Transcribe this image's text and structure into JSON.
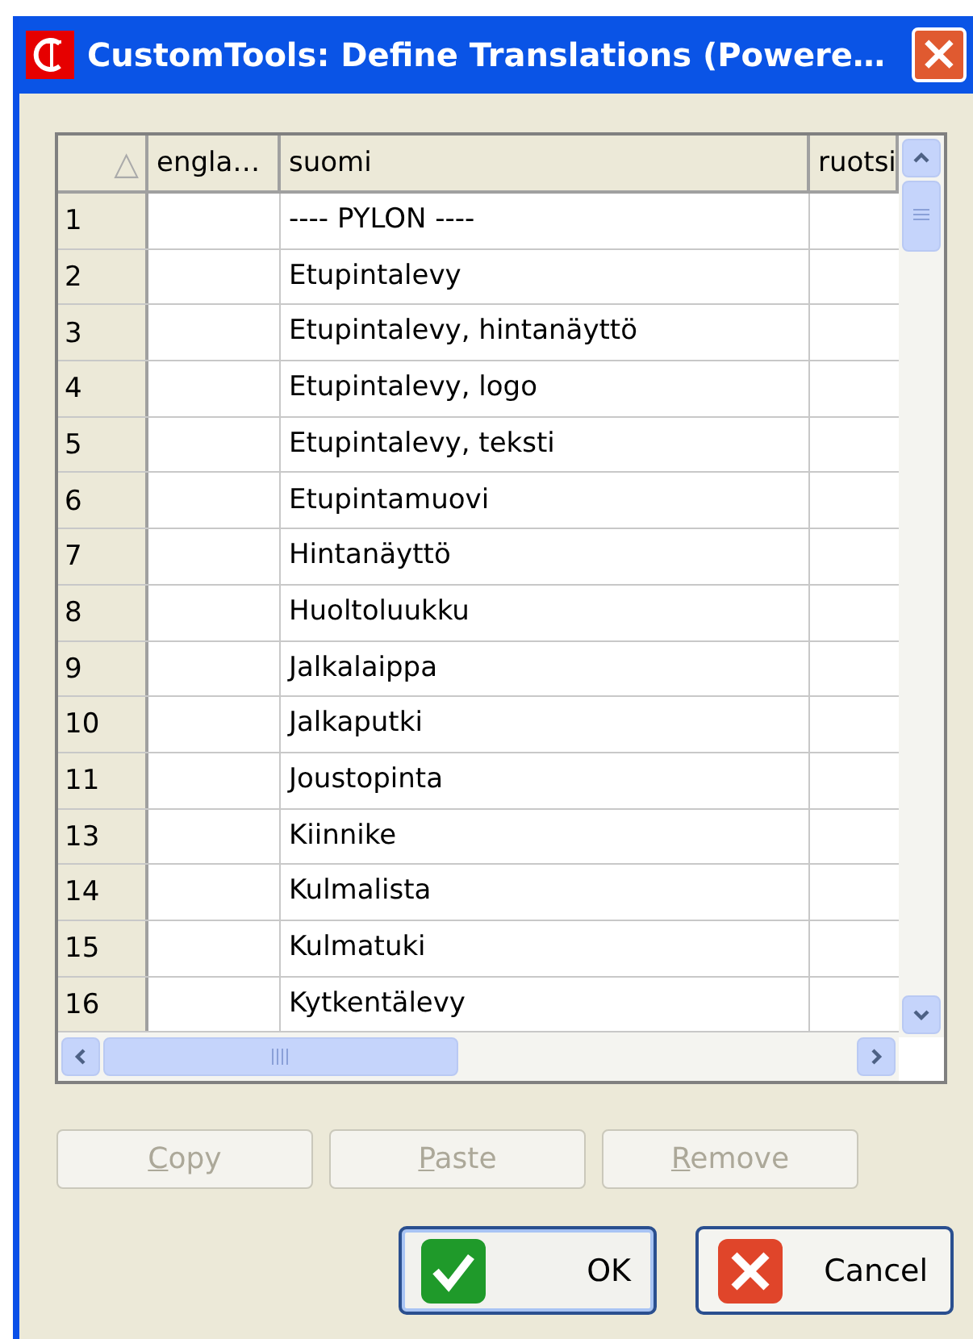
{
  "window": {
    "title": "CustomTools: Define Translations (Powere…",
    "close": "×"
  },
  "table": {
    "sort_indicator": "△",
    "columns": [
      "engla…",
      "suomi",
      "ruotsi"
    ],
    "rows": [
      {
        "number": "1",
        "suomi": "---- PYLON ----"
      },
      {
        "number": "2",
        "suomi": "Etupintalevy"
      },
      {
        "number": "3",
        "suomi": "Etupintalevy, hintanäyttö"
      },
      {
        "number": "4",
        "suomi": "Etupintalevy, logo"
      },
      {
        "number": "5",
        "suomi": "Etupintalevy, teksti"
      },
      {
        "number": "6",
        "suomi": "Etupintamuovi"
      },
      {
        "number": "7",
        "suomi": "Hintanäyttö"
      },
      {
        "number": "8",
        "suomi": "Huoltoluukku"
      },
      {
        "number": "9",
        "suomi": "Jalkalaippa"
      },
      {
        "number": "10",
        "suomi": "Jalkaputki"
      },
      {
        "number": "11",
        "suomi": "Joustopinta"
      },
      {
        "number": "13",
        "suomi": "Kiinnike"
      },
      {
        "number": "14",
        "suomi": "Kulmalista"
      },
      {
        "number": "15",
        "suomi": "Kulmatuki"
      },
      {
        "number": "16",
        "suomi": "Kytkentälevy"
      }
    ]
  },
  "edit_buttons": [
    {
      "label": "Copy",
      "disabled": true
    },
    {
      "label": "Paste",
      "disabled": true
    },
    {
      "label": "Remove",
      "disabled": true
    }
  ],
  "dialog_buttons": [
    {
      "label": "OK",
      "kind": "ok"
    },
    {
      "label": "Cancel",
      "kind": "cancel"
    }
  ]
}
